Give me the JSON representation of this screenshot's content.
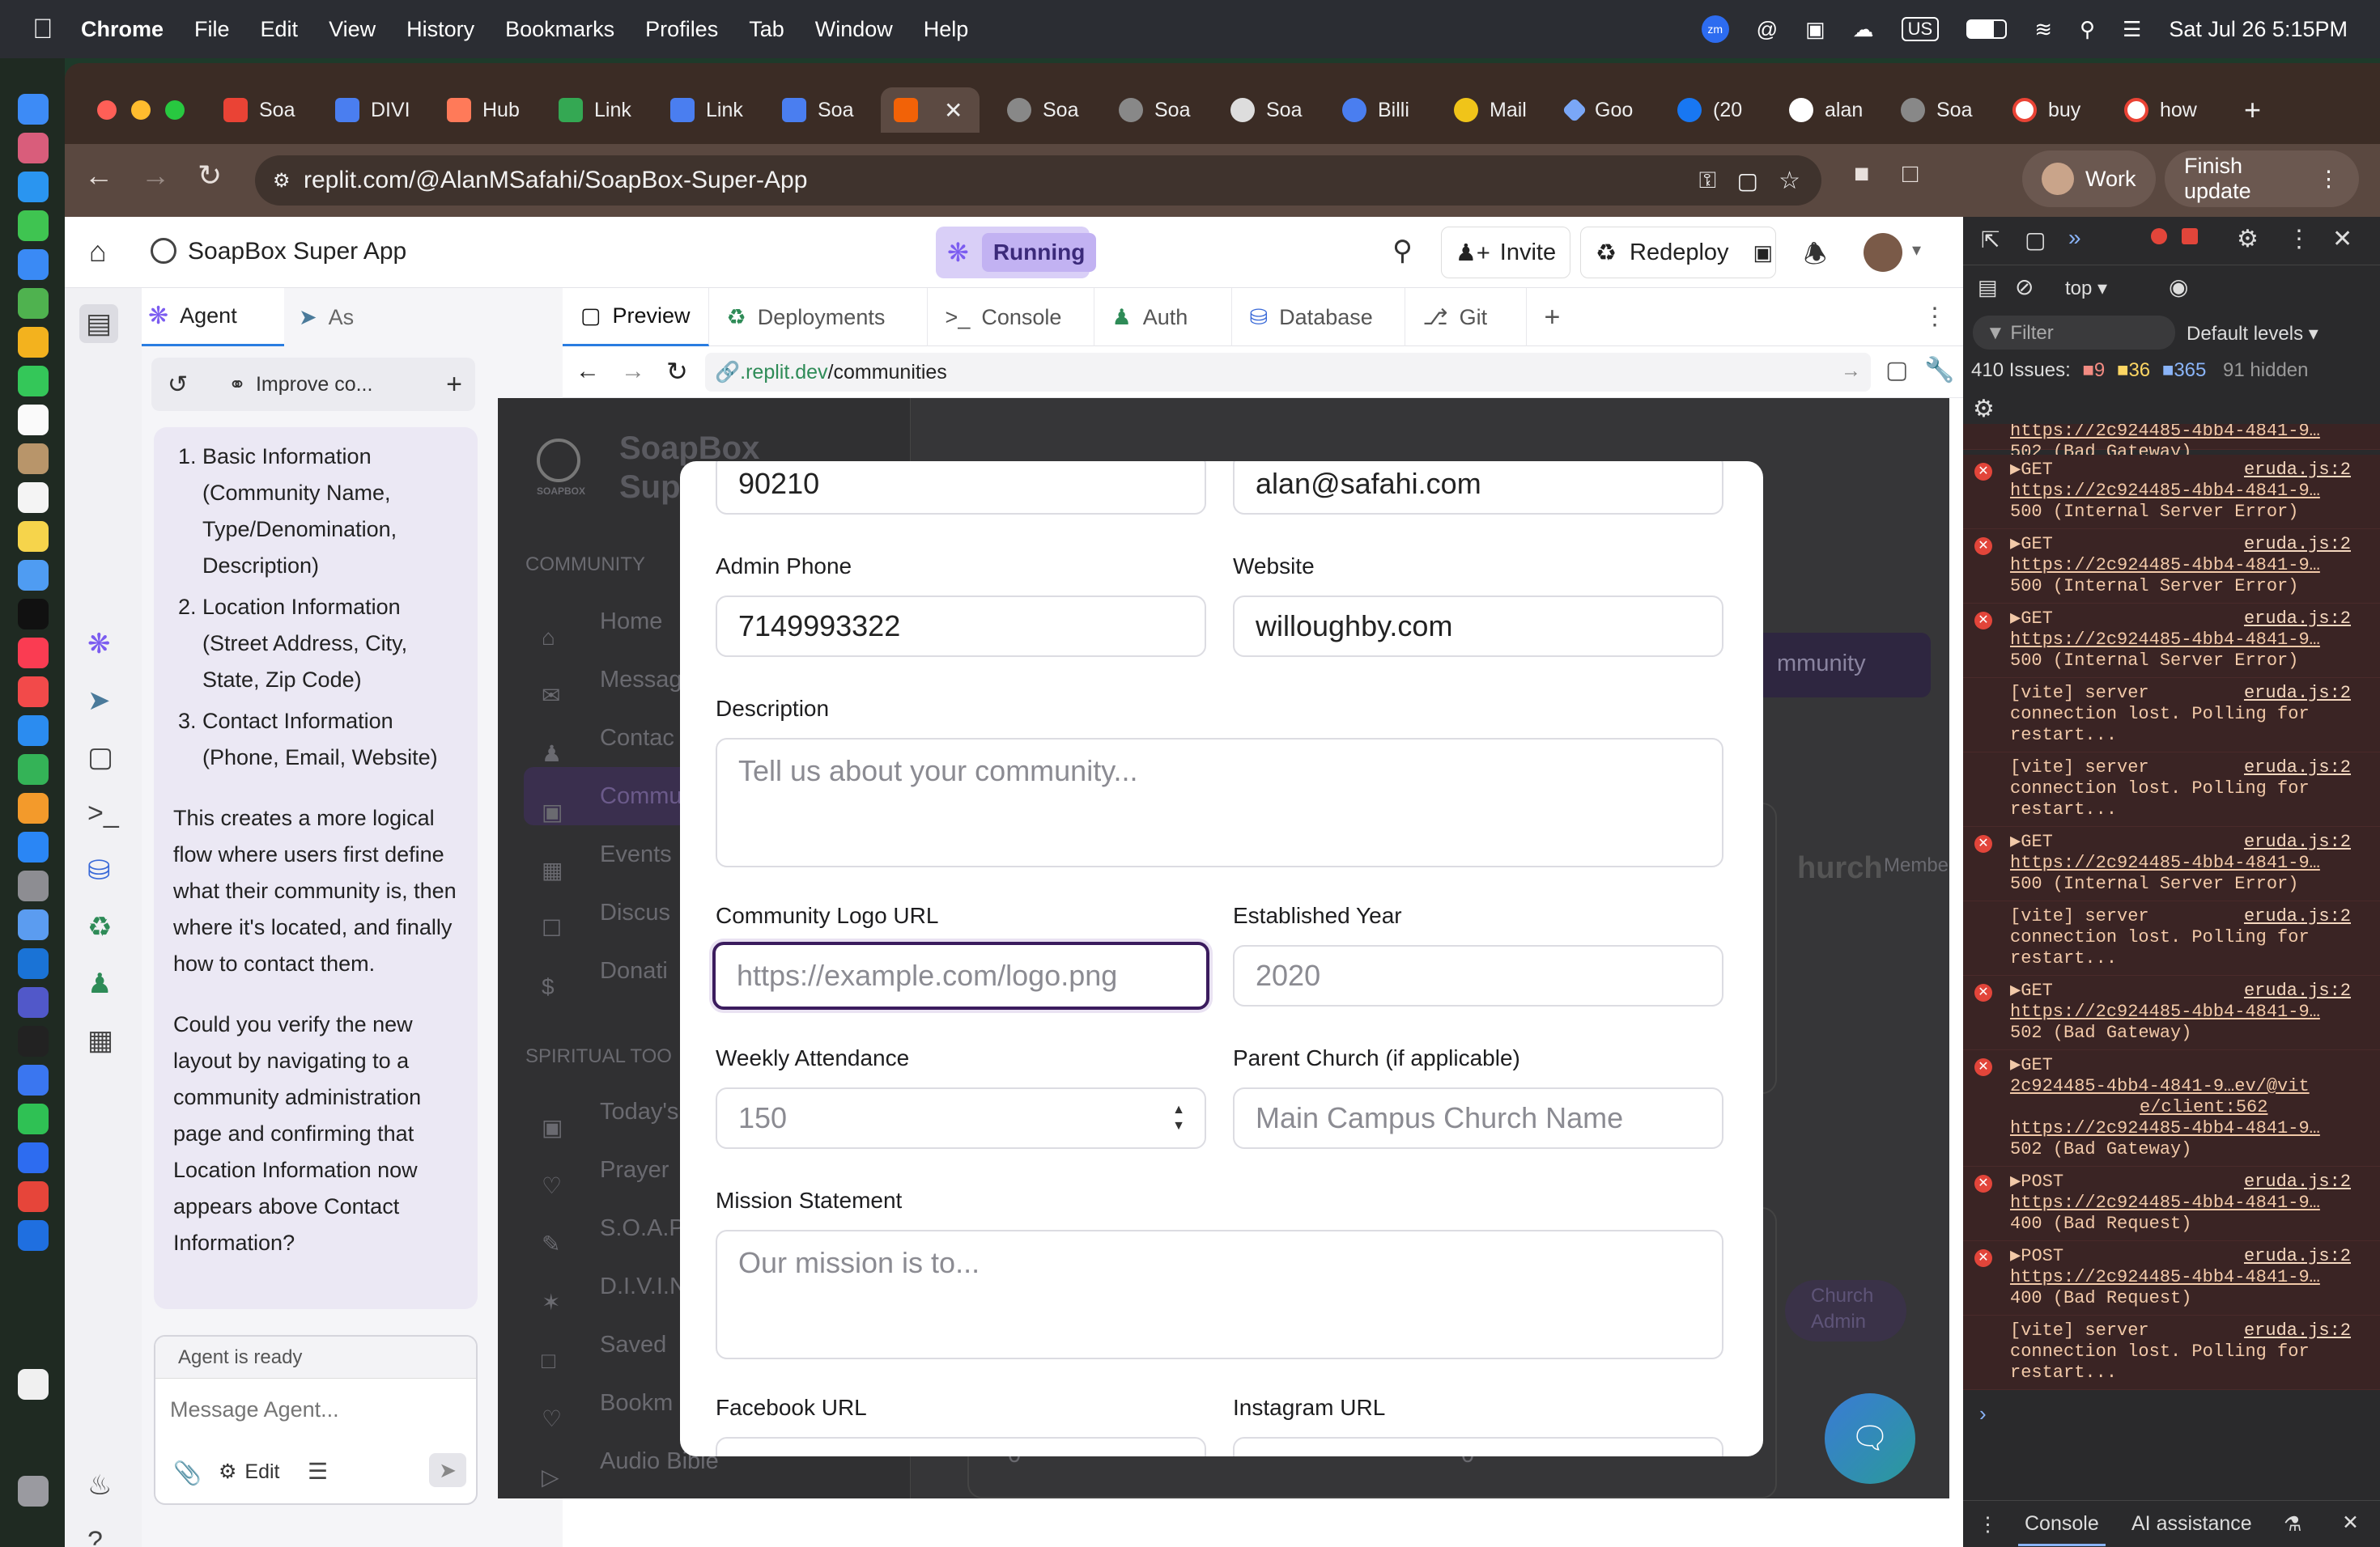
{
  "menubar": {
    "items": [
      "Chrome",
      "File",
      "Edit",
      "View",
      "History",
      "Bookmarks",
      "Profiles",
      "Tab",
      "Window",
      "Help"
    ],
    "clock": "Sat Jul 26  5:15PM",
    "tray_badge": "US"
  },
  "browser": {
    "tabs": [
      "Soa",
      "DIVI",
      "Hub",
      "Link",
      "Link",
      "Soa",
      "",
      "Soa",
      "Soa",
      "Soa",
      "Billi",
      "Mail",
      "Goo",
      "(20",
      "alan",
      "Soa",
      "buy",
      "how"
    ],
    "url": "replit.com/@AlanMSafahi/SoapBox-Super-App",
    "profile_label": "Work",
    "update_label": "Finish update"
  },
  "replit": {
    "project_name": "SoapBox Super App",
    "status": "Running",
    "invite_label": "Invite",
    "redeploy_label": "Redeploy",
    "panel_tabs": [
      "Agent",
      "As"
    ],
    "history_label": "Improve co...",
    "workspace_tabs": [
      "Preview",
      "Deployments",
      "Console",
      "Auth",
      "Database",
      "Git"
    ],
    "preview_url_host": ".replit.dev",
    "preview_url_path": "/communities",
    "agent_status": "Agent is ready",
    "message_placeholder": "Message Agent...",
    "edit_label": "Edit"
  },
  "chat": {
    "list": [
      "Basic Information (Community Name, Type/Denomination, Description)",
      "Location Information (Street Address, City, State, Zip Code)",
      "Contact Information (Phone, Email, Website)"
    ],
    "para1": "This creates a more logical flow where users first define what their community is, then where it's located, and finally how to contact them.",
    "para2": "Could you verify the new layout by navigating to a community administration page and confirming that Location Information now appears above Contact Information?"
  },
  "background_app": {
    "brand_top": "SoapBox",
    "brand_bottom": "Sup",
    "logo_sub": "SOAPBOX",
    "section_community": "COMMUNITY",
    "nav": [
      "Home",
      "Messag",
      "Contac",
      "Commu",
      "Events",
      "Discus",
      "Donati"
    ],
    "section_spiritual": "SPIRITUAL TOO",
    "nav2": [
      "Today's",
      "Prayer",
      "S.O.A.P",
      "D.I.V.I.N",
      "Saved",
      "Bookm",
      "Audio Bible"
    ],
    "create_btn": "mmunity",
    "church_text": "hurch",
    "member_text": "Member",
    "church_admin": "Church Admin",
    "zero_a": "0",
    "zero_b": "0"
  },
  "modal": {
    "zip_value": "90210",
    "email_value": "alan@safahi.com",
    "admin_phone_label": "Admin Phone",
    "admin_phone_value": "7149993322",
    "website_label": "Website",
    "website_value": "willoughby.com",
    "description_label": "Description",
    "description_placeholder": "Tell us about your community...",
    "logo_label": "Community Logo URL",
    "logo_placeholder": "https://example.com/logo.png",
    "established_label": "Established Year",
    "established_placeholder": "2020",
    "attendance_label": "Weekly Attendance",
    "attendance_placeholder": "150",
    "parent_label": "Parent Church (if applicable)",
    "parent_placeholder": "Main Campus Church Name",
    "mission_label": "Mission Statement",
    "mission_placeholder": "Our mission is to...",
    "facebook_label": "Facebook URL",
    "instagram_label": "Instagram URL"
  },
  "devtools": {
    "context": "top",
    "filter_placeholder": "Filter",
    "levels": "Default levels",
    "issues_label": "410 Issues:",
    "issues_err": "9",
    "issues_warn": "36",
    "issues_info": "365",
    "hidden": "91 hidden",
    "console_tab": "Console",
    "ai_tab": "AI assistance",
    "rows": [
      {
        "l1": "https://2c924485-4bb4-4841-9…",
        "l2": "502 (Bad Gateway)",
        "src": ""
      },
      {
        "l1": "▶GET",
        "src": "eruda.js:2",
        "l2": "https://2c924485-4bb4-4841-9…",
        "l3": "500 (Internal Server Error)"
      },
      {
        "l1": "▶GET",
        "src": "eruda.js:2",
        "l2": "https://2c924485-4bb4-4841-9…",
        "l3": "500 (Internal Server Error)"
      },
      {
        "l1": "▶GET",
        "src": "eruda.js:2",
        "l2": "https://2c924485-4bb4-4841-9…",
        "l3": "500 (Internal Server Error)"
      },
      {
        "l1": "[vite] server",
        "src": "eruda.js:2",
        "l2": "connection lost. Polling for",
        "l3": "restart..."
      },
      {
        "l1": "[vite] server",
        "src": "eruda.js:2",
        "l2": "connection lost. Polling for",
        "l3": "restart..."
      },
      {
        "l1": "▶GET",
        "src": "eruda.js:2",
        "l2": "https://2c924485-4bb4-4841-9…",
        "l3": "500 (Internal Server Error)"
      },
      {
        "l1": "[vite] server",
        "src": "eruda.js:2",
        "l2": "connection lost. Polling for",
        "l3": "restart..."
      },
      {
        "l1": "▶GET",
        "src": "eruda.js:2",
        "l2": "https://2c924485-4bb4-4841-9…",
        "l3": "502 (Bad Gateway)"
      },
      {
        "l1": "▶GET",
        "src": "",
        "l2": "2c924485-4bb4-4841-9…ev/@vit",
        "l3": "e/client:562",
        "l4": "https://2c924485-4bb4-4841-9…",
        "l5": "502 (Bad Gateway)"
      },
      {
        "l1": "▶POST",
        "src": "eruda.js:2",
        "l2": "https://2c924485-4bb4-4841-9…",
        "l3": "400 (Bad Request)"
      },
      {
        "l1": "▶POST",
        "src": "eruda.js:2",
        "l2": "https://2c924485-4bb4-4841-9…",
        "l3": "400 (Bad Request)"
      },
      {
        "l1": "[vite] server",
        "src": "eruda.js:2",
        "l2": "connection lost. Polling for",
        "l3": "restart..."
      }
    ]
  },
  "colors": {
    "accent": "#7b5cf0",
    "running_bg": "#d9cff7",
    "focus_ring": "#3b1c5e",
    "error": "#e2453a"
  }
}
